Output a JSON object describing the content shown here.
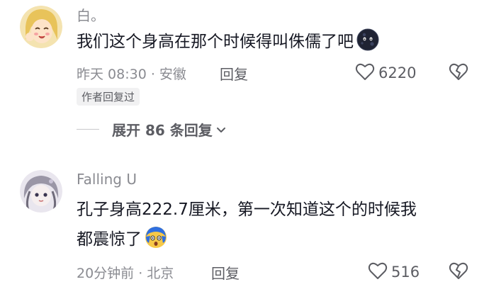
{
  "comments": [
    {
      "username": "白。",
      "text": "我们这个身高在那个时候得叫侏儒了吧",
      "emoji_icon": "dark-moon-face-emoji",
      "time_location": "昨天 08:30 · 安徽",
      "reply_label": "回复",
      "likes": "6220",
      "author_badge": "作者回复过",
      "expand_label": "展开 86 条回复"
    },
    {
      "username": "Falling U",
      "text_line1": "孔子身高222.7厘米，第一次知道这个的时候我",
      "text_line2": "都震惊了",
      "emoji_icon": "shocked-face-emoji",
      "time_location": "20分钟前 · 北京",
      "reply_label": "回复",
      "likes": "516"
    }
  ],
  "icons": {
    "like": "heart-outline-icon",
    "dislike": "broken-heart-icon",
    "expand": "chevron-down-icon"
  },
  "colors": {
    "primary_text": "#161823",
    "secondary_text": "#8a8b91",
    "action_text": "#5c5d63",
    "badge_bg": "#f1f1f2"
  }
}
